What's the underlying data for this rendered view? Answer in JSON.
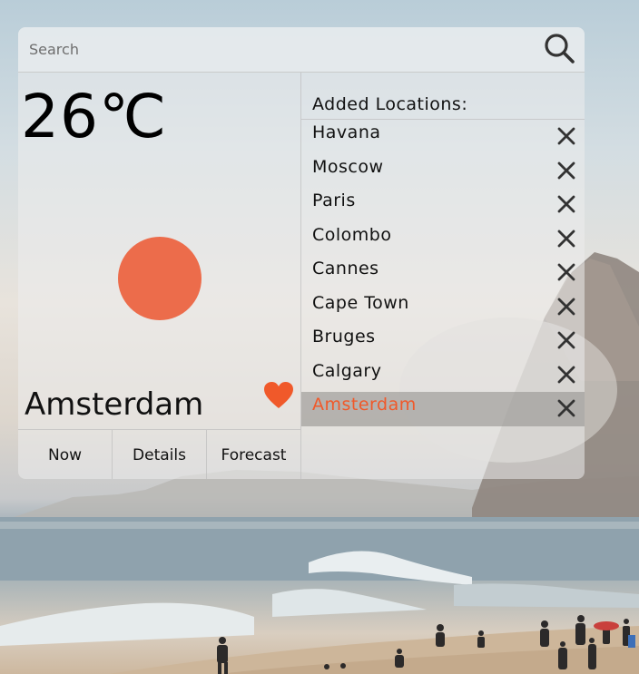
{
  "search": {
    "placeholder": "Search",
    "icon": "search-icon"
  },
  "weather": {
    "temperature": "26℃",
    "condition_icon": "sun-icon",
    "city": "Amsterdam",
    "favorite_icon": "heart-icon",
    "accent_color": "#ec6c4b"
  },
  "tabs": [
    {
      "label": "Now"
    },
    {
      "label": "Details"
    },
    {
      "label": "Forecast"
    }
  ],
  "locations": {
    "header": "Added Locations:",
    "remove_icon": "close-icon",
    "selected_color": "#f0592a",
    "items": [
      {
        "name": "Havana",
        "selected": false
      },
      {
        "name": "Moscow",
        "selected": false
      },
      {
        "name": "Paris",
        "selected": false
      },
      {
        "name": "Colombo",
        "selected": false
      },
      {
        "name": "Cannes",
        "selected": false
      },
      {
        "name": "Cape Town",
        "selected": false
      },
      {
        "name": "Bruges",
        "selected": false
      },
      {
        "name": "Calgary",
        "selected": false
      },
      {
        "name": "Amsterdam",
        "selected": true
      }
    ]
  }
}
